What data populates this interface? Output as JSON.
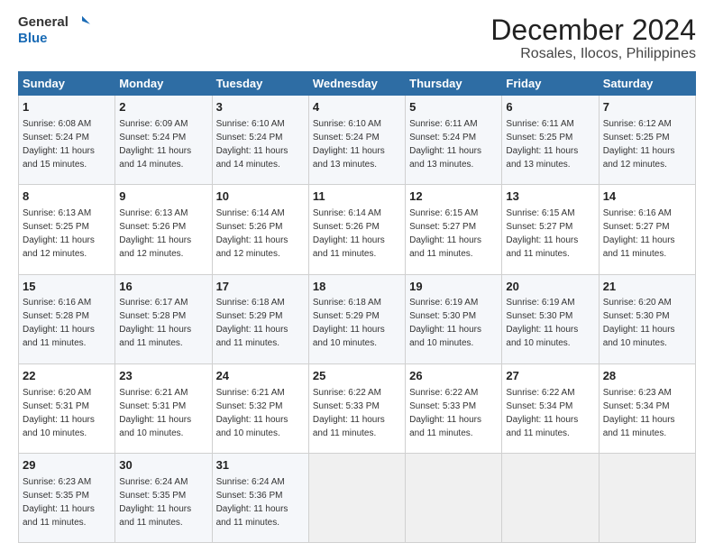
{
  "logo": {
    "line1": "General",
    "line2": "Blue"
  },
  "title": "December 2024",
  "subtitle": "Rosales, Ilocos, Philippines",
  "days_of_week": [
    "Sunday",
    "Monday",
    "Tuesday",
    "Wednesday",
    "Thursday",
    "Friday",
    "Saturday"
  ],
  "weeks": [
    [
      {
        "day": 1,
        "sunrise": "6:08 AM",
        "sunset": "5:24 PM",
        "daylight": "11 hours and 15 minutes."
      },
      {
        "day": 2,
        "sunrise": "6:09 AM",
        "sunset": "5:24 PM",
        "daylight": "11 hours and 14 minutes."
      },
      {
        "day": 3,
        "sunrise": "6:10 AM",
        "sunset": "5:24 PM",
        "daylight": "11 hours and 14 minutes."
      },
      {
        "day": 4,
        "sunrise": "6:10 AM",
        "sunset": "5:24 PM",
        "daylight": "11 hours and 13 minutes."
      },
      {
        "day": 5,
        "sunrise": "6:11 AM",
        "sunset": "5:24 PM",
        "daylight": "11 hours and 13 minutes."
      },
      {
        "day": 6,
        "sunrise": "6:11 AM",
        "sunset": "5:25 PM",
        "daylight": "11 hours and 13 minutes."
      },
      {
        "day": 7,
        "sunrise": "6:12 AM",
        "sunset": "5:25 PM",
        "daylight": "11 hours and 12 minutes."
      }
    ],
    [
      {
        "day": 8,
        "sunrise": "6:13 AM",
        "sunset": "5:25 PM",
        "daylight": "11 hours and 12 minutes."
      },
      {
        "day": 9,
        "sunrise": "6:13 AM",
        "sunset": "5:26 PM",
        "daylight": "11 hours and 12 minutes."
      },
      {
        "day": 10,
        "sunrise": "6:14 AM",
        "sunset": "5:26 PM",
        "daylight": "11 hours and 12 minutes."
      },
      {
        "day": 11,
        "sunrise": "6:14 AM",
        "sunset": "5:26 PM",
        "daylight": "11 hours and 11 minutes."
      },
      {
        "day": 12,
        "sunrise": "6:15 AM",
        "sunset": "5:27 PM",
        "daylight": "11 hours and 11 minutes."
      },
      {
        "day": 13,
        "sunrise": "6:15 AM",
        "sunset": "5:27 PM",
        "daylight": "11 hours and 11 minutes."
      },
      {
        "day": 14,
        "sunrise": "6:16 AM",
        "sunset": "5:27 PM",
        "daylight": "11 hours and 11 minutes."
      }
    ],
    [
      {
        "day": 15,
        "sunrise": "6:16 AM",
        "sunset": "5:28 PM",
        "daylight": "11 hours and 11 minutes."
      },
      {
        "day": 16,
        "sunrise": "6:17 AM",
        "sunset": "5:28 PM",
        "daylight": "11 hours and 11 minutes."
      },
      {
        "day": 17,
        "sunrise": "6:18 AM",
        "sunset": "5:29 PM",
        "daylight": "11 hours and 11 minutes."
      },
      {
        "day": 18,
        "sunrise": "6:18 AM",
        "sunset": "5:29 PM",
        "daylight": "11 hours and 10 minutes."
      },
      {
        "day": 19,
        "sunrise": "6:19 AM",
        "sunset": "5:30 PM",
        "daylight": "11 hours and 10 minutes."
      },
      {
        "day": 20,
        "sunrise": "6:19 AM",
        "sunset": "5:30 PM",
        "daylight": "11 hours and 10 minutes."
      },
      {
        "day": 21,
        "sunrise": "6:20 AM",
        "sunset": "5:30 PM",
        "daylight": "11 hours and 10 minutes."
      }
    ],
    [
      {
        "day": 22,
        "sunrise": "6:20 AM",
        "sunset": "5:31 PM",
        "daylight": "11 hours and 10 minutes."
      },
      {
        "day": 23,
        "sunrise": "6:21 AM",
        "sunset": "5:31 PM",
        "daylight": "11 hours and 10 minutes."
      },
      {
        "day": 24,
        "sunrise": "6:21 AM",
        "sunset": "5:32 PM",
        "daylight": "11 hours and 10 minutes."
      },
      {
        "day": 25,
        "sunrise": "6:22 AM",
        "sunset": "5:33 PM",
        "daylight": "11 hours and 11 minutes."
      },
      {
        "day": 26,
        "sunrise": "6:22 AM",
        "sunset": "5:33 PM",
        "daylight": "11 hours and 11 minutes."
      },
      {
        "day": 27,
        "sunrise": "6:22 AM",
        "sunset": "5:34 PM",
        "daylight": "11 hours and 11 minutes."
      },
      {
        "day": 28,
        "sunrise": "6:23 AM",
        "sunset": "5:34 PM",
        "daylight": "11 hours and 11 minutes."
      }
    ],
    [
      {
        "day": 29,
        "sunrise": "6:23 AM",
        "sunset": "5:35 PM",
        "daylight": "11 hours and 11 minutes."
      },
      {
        "day": 30,
        "sunrise": "6:24 AM",
        "sunset": "5:35 PM",
        "daylight": "11 hours and 11 minutes."
      },
      {
        "day": 31,
        "sunrise": "6:24 AM",
        "sunset": "5:36 PM",
        "daylight": "11 hours and 11 minutes."
      },
      null,
      null,
      null,
      null
    ]
  ]
}
